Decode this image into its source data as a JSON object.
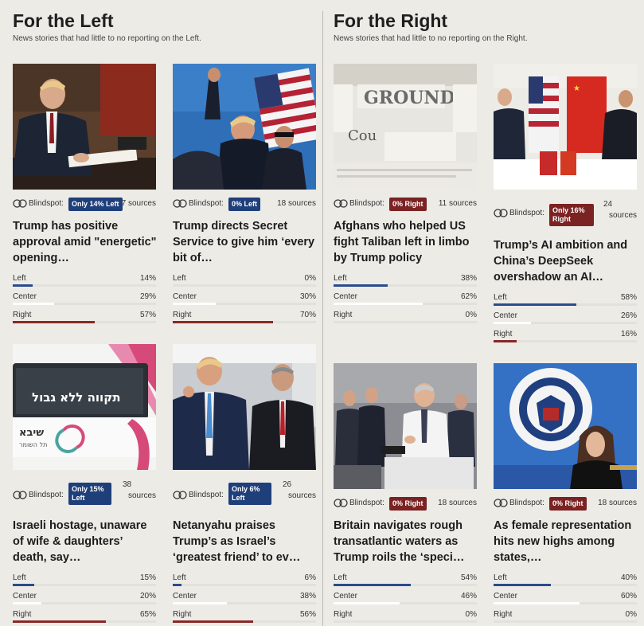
{
  "colors": {
    "left": "#2b4c8c",
    "center": "#ffffff",
    "right": "#8a2727",
    "badge_left": "#1f3f7a",
    "badge_right": "#7b2222"
  },
  "left": {
    "title": "For the Left",
    "subtitle": "News stories that had little to no reporting on the Left."
  },
  "right": {
    "title": "For the Right",
    "subtitle": "News stories that had little to no reporting on the Right."
  },
  "blindspot_label": "Blindspot:",
  "bar_labels": {
    "left": "Left",
    "center": "Center",
    "right": "Right"
  },
  "cards": [
    {
      "badge": "Only 14% Left",
      "sources": "7 sources",
      "headline": "Trump has positive approval amid \"energetic\" opening…",
      "left": "14%",
      "center": "29%",
      "right": "57%",
      "lv": 14,
      "cv": 29,
      "rv": 57
    },
    {
      "badge": "0% Left",
      "sources": "18 sources",
      "headline": "Trump directs Secret Service to give him ‘every bit of…",
      "left": "0%",
      "center": "30%",
      "right": "70%",
      "lv": 0,
      "cv": 30,
      "rv": 70
    },
    {
      "badge": "0% Right",
      "sources": "11 sources",
      "headline": "Afghans who helped US fight Taliban left in limbo by Trump policy",
      "left": "38%",
      "center": "62%",
      "right": "0%",
      "lv": 38,
      "cv": 62,
      "rv": 0
    },
    {
      "badge": "Only 16% Right",
      "sources_n": "24",
      "sources_w": "sources",
      "headline": "Trump’s AI ambition and China’s DeepSeek overshadow an AI…",
      "left": "58%",
      "center": "26%",
      "right": "16%",
      "lv": 58,
      "cv": 26,
      "rv": 16
    },
    {
      "badge": "Only 15% Left",
      "sources_n": "38",
      "sources_w": "sources",
      "headline": "Israeli hostage, unaware of wife & daughters’ death, say…",
      "left": "15%",
      "center": "20%",
      "right": "65%",
      "lv": 15,
      "cv": 20,
      "rv": 65,
      "bus_text": "תקווה ללא גבול",
      "bus_brand": "שיבא",
      "bus_sub": "תל השומר"
    },
    {
      "badge": "Only 6% Left",
      "sources_n": "26",
      "sources_w": "sources",
      "headline": "Netanyahu praises Trump’s as Israel’s ‘greatest friend’ to ev…",
      "left": "6%",
      "center": "38%",
      "right": "56%",
      "lv": 6,
      "cv": 38,
      "rv": 56
    },
    {
      "badge": "0% Right",
      "sources": "18 sources",
      "headline": "Britain navigates rough transatlantic waters as Trump roils the ‘speci…",
      "left": "54%",
      "center": "46%",
      "right": "0%",
      "lv": 54,
      "cv": 46,
      "rv": 0
    },
    {
      "badge": "0% Right",
      "sources": "18 sources",
      "headline": "As female representation hits new highs among states,…",
      "left": "40%",
      "center": "60%",
      "right": "0%",
      "lv": 40,
      "cv": 60,
      "rv": 0
    }
  ],
  "icons": {
    "blindspot": "blindspot-icon"
  }
}
